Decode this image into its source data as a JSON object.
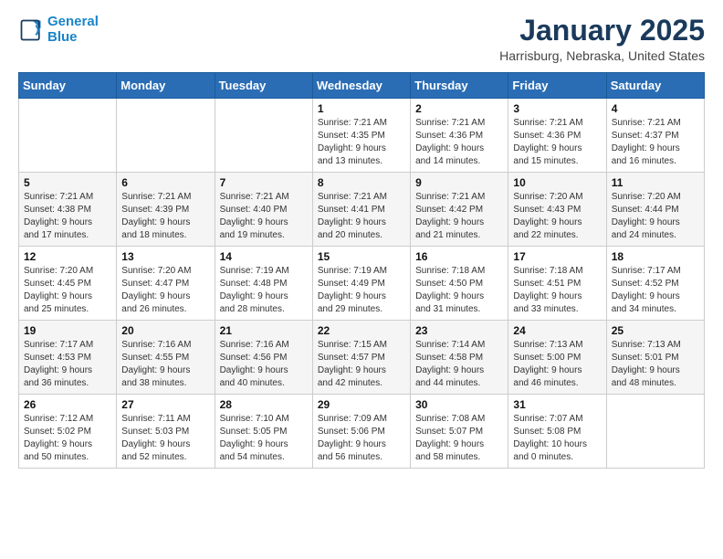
{
  "logo": {
    "line1": "General",
    "line2": "Blue"
  },
  "title": "January 2025",
  "location": "Harrisburg, Nebraska, United States",
  "weekdays": [
    "Sunday",
    "Monday",
    "Tuesday",
    "Wednesday",
    "Thursday",
    "Friday",
    "Saturday"
  ],
  "weeks": [
    [
      {
        "day": "",
        "info": ""
      },
      {
        "day": "",
        "info": ""
      },
      {
        "day": "",
        "info": ""
      },
      {
        "day": "1",
        "info": "Sunrise: 7:21 AM\nSunset: 4:35 PM\nDaylight: 9 hours\nand 13 minutes."
      },
      {
        "day": "2",
        "info": "Sunrise: 7:21 AM\nSunset: 4:36 PM\nDaylight: 9 hours\nand 14 minutes."
      },
      {
        "day": "3",
        "info": "Sunrise: 7:21 AM\nSunset: 4:36 PM\nDaylight: 9 hours\nand 15 minutes."
      },
      {
        "day": "4",
        "info": "Sunrise: 7:21 AM\nSunset: 4:37 PM\nDaylight: 9 hours\nand 16 minutes."
      }
    ],
    [
      {
        "day": "5",
        "info": "Sunrise: 7:21 AM\nSunset: 4:38 PM\nDaylight: 9 hours\nand 17 minutes."
      },
      {
        "day": "6",
        "info": "Sunrise: 7:21 AM\nSunset: 4:39 PM\nDaylight: 9 hours\nand 18 minutes."
      },
      {
        "day": "7",
        "info": "Sunrise: 7:21 AM\nSunset: 4:40 PM\nDaylight: 9 hours\nand 19 minutes."
      },
      {
        "day": "8",
        "info": "Sunrise: 7:21 AM\nSunset: 4:41 PM\nDaylight: 9 hours\nand 20 minutes."
      },
      {
        "day": "9",
        "info": "Sunrise: 7:21 AM\nSunset: 4:42 PM\nDaylight: 9 hours\nand 21 minutes."
      },
      {
        "day": "10",
        "info": "Sunrise: 7:20 AM\nSunset: 4:43 PM\nDaylight: 9 hours\nand 22 minutes."
      },
      {
        "day": "11",
        "info": "Sunrise: 7:20 AM\nSunset: 4:44 PM\nDaylight: 9 hours\nand 24 minutes."
      }
    ],
    [
      {
        "day": "12",
        "info": "Sunrise: 7:20 AM\nSunset: 4:45 PM\nDaylight: 9 hours\nand 25 minutes."
      },
      {
        "day": "13",
        "info": "Sunrise: 7:20 AM\nSunset: 4:47 PM\nDaylight: 9 hours\nand 26 minutes."
      },
      {
        "day": "14",
        "info": "Sunrise: 7:19 AM\nSunset: 4:48 PM\nDaylight: 9 hours\nand 28 minutes."
      },
      {
        "day": "15",
        "info": "Sunrise: 7:19 AM\nSunset: 4:49 PM\nDaylight: 9 hours\nand 29 minutes."
      },
      {
        "day": "16",
        "info": "Sunrise: 7:18 AM\nSunset: 4:50 PM\nDaylight: 9 hours\nand 31 minutes."
      },
      {
        "day": "17",
        "info": "Sunrise: 7:18 AM\nSunset: 4:51 PM\nDaylight: 9 hours\nand 33 minutes."
      },
      {
        "day": "18",
        "info": "Sunrise: 7:17 AM\nSunset: 4:52 PM\nDaylight: 9 hours\nand 34 minutes."
      }
    ],
    [
      {
        "day": "19",
        "info": "Sunrise: 7:17 AM\nSunset: 4:53 PM\nDaylight: 9 hours\nand 36 minutes."
      },
      {
        "day": "20",
        "info": "Sunrise: 7:16 AM\nSunset: 4:55 PM\nDaylight: 9 hours\nand 38 minutes."
      },
      {
        "day": "21",
        "info": "Sunrise: 7:16 AM\nSunset: 4:56 PM\nDaylight: 9 hours\nand 40 minutes."
      },
      {
        "day": "22",
        "info": "Sunrise: 7:15 AM\nSunset: 4:57 PM\nDaylight: 9 hours\nand 42 minutes."
      },
      {
        "day": "23",
        "info": "Sunrise: 7:14 AM\nSunset: 4:58 PM\nDaylight: 9 hours\nand 44 minutes."
      },
      {
        "day": "24",
        "info": "Sunrise: 7:13 AM\nSunset: 5:00 PM\nDaylight: 9 hours\nand 46 minutes."
      },
      {
        "day": "25",
        "info": "Sunrise: 7:13 AM\nSunset: 5:01 PM\nDaylight: 9 hours\nand 48 minutes."
      }
    ],
    [
      {
        "day": "26",
        "info": "Sunrise: 7:12 AM\nSunset: 5:02 PM\nDaylight: 9 hours\nand 50 minutes."
      },
      {
        "day": "27",
        "info": "Sunrise: 7:11 AM\nSunset: 5:03 PM\nDaylight: 9 hours\nand 52 minutes."
      },
      {
        "day": "28",
        "info": "Sunrise: 7:10 AM\nSunset: 5:05 PM\nDaylight: 9 hours\nand 54 minutes."
      },
      {
        "day": "29",
        "info": "Sunrise: 7:09 AM\nSunset: 5:06 PM\nDaylight: 9 hours\nand 56 minutes."
      },
      {
        "day": "30",
        "info": "Sunrise: 7:08 AM\nSunset: 5:07 PM\nDaylight: 9 hours\nand 58 minutes."
      },
      {
        "day": "31",
        "info": "Sunrise: 7:07 AM\nSunset: 5:08 PM\nDaylight: 10 hours\nand 0 minutes."
      },
      {
        "day": "",
        "info": ""
      }
    ]
  ]
}
